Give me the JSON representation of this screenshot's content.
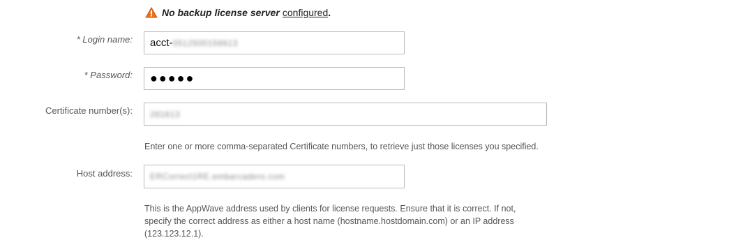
{
  "warning": {
    "icon": "warning-triangle-icon",
    "icon_color": "#e8731a",
    "text": "No backup license server",
    "link": "configured",
    "suffix": "."
  },
  "login": {
    "label": "* Login name:",
    "prefix": "acct-",
    "blurred": "0512500156613"
  },
  "password": {
    "label": "* Password:",
    "masked": "●●●●●"
  },
  "certificate": {
    "label": "Certificate number(s):",
    "blurred": "281613",
    "help": "Enter one or more comma-separated Certificate numbers, to retrieve just those licenses you specified."
  },
  "host": {
    "label": "Host address:",
    "blurred": "ERCorrect1RE.embarcadero.com",
    "help_line1": "This is the AppWave address used by clients for license requests. Ensure that it is correct. If not,",
    "help_line2": "specify the correct address as either a host name (hostname.hostdomain.com) or an IP address",
    "help_line3": "(123.123.12.1)."
  }
}
